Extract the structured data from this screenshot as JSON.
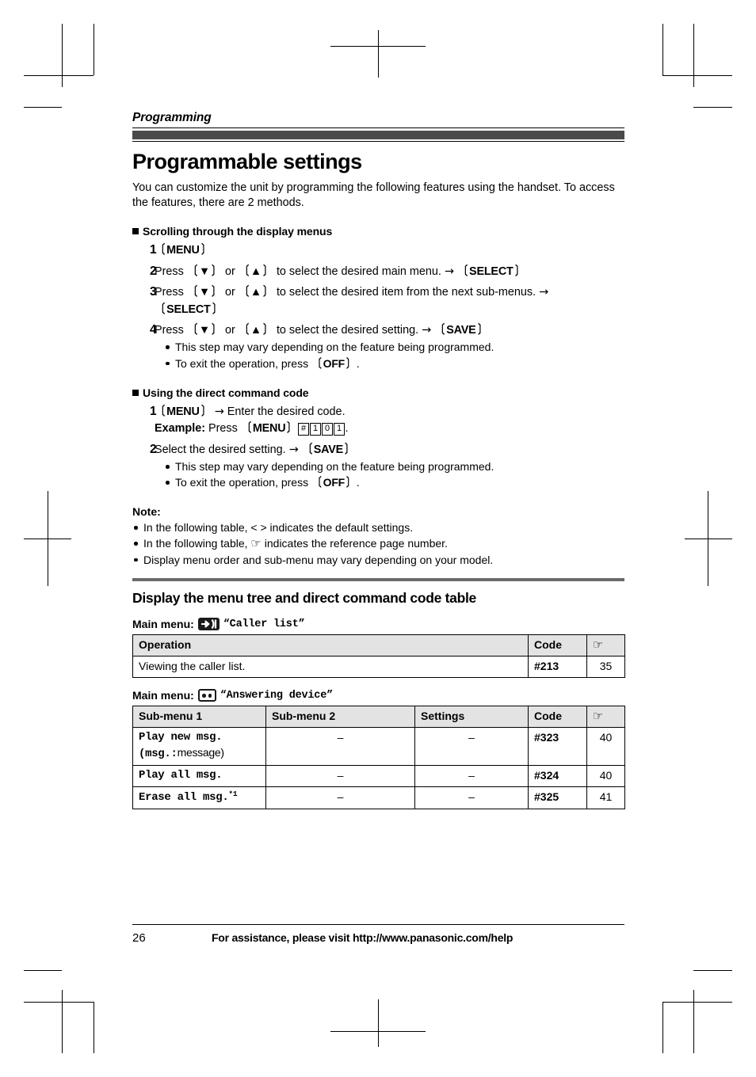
{
  "running_head": "Programming",
  "title": "Programmable settings",
  "intro": "You can customize the unit by programming the following features using the handset. To access the features, there are 2 methods.",
  "section_scrolling": {
    "heading": "Scrolling through the display menus",
    "steps": [
      {
        "num": "1",
        "text_pre": "",
        "key": "MENU",
        "text_post": ""
      },
      {
        "num": "2",
        "text": "Press 〔▼〕 or 〔▲〕 to select the desired main menu. → 〔SELECT〕"
      },
      {
        "num": "3",
        "text": "Press 〔▼〕 or 〔▲〕 to select the desired item from the next sub-menus. → 〔SELECT〕"
      },
      {
        "num": "4",
        "text": "Press 〔▼〕 or 〔▲〕 to select the desired setting. → 〔SAVE〕"
      }
    ],
    "step1_key": "MENU",
    "step2_press": "Press",
    "step2_or": "or",
    "step2_tail": "to select the desired main menu.",
    "step2_key": "SELECT",
    "step3_tail": "to select the desired item from the next sub-menus.",
    "step3_key": "SELECT",
    "step4_tail": "to select the desired setting.",
    "step4_key": "SAVE",
    "bullets": [
      "This step may vary depending on the feature being programmed.",
      "To exit the operation, press"
    ],
    "off_key": "OFF"
  },
  "section_direct": {
    "heading": "Using the direct command code",
    "step1_key": "MENU",
    "step1_text": "Enter the desired code.",
    "example_label": "Example:",
    "example_press": "Press",
    "example_key": "MENU",
    "example_keys": [
      "#",
      "1",
      "0",
      "1"
    ],
    "step2_text": "Select the desired setting.",
    "step2_key": "SAVE",
    "bullets": [
      "This step may vary depending on the feature being programmed.",
      "To exit the operation, press"
    ],
    "off_key": "OFF"
  },
  "note": {
    "label": "Note:",
    "items": [
      "In the following table, < > indicates the default settings.",
      "In the following table, ☞ indicates the reference page number.",
      "Display menu order and sub-menu may vary depending on your model."
    ],
    "item2_pre": "In the following table,",
    "item2_post": "indicates the reference page number."
  },
  "menu_tree": {
    "heading": "Display the menu tree and direct command code table",
    "main_menu_label": "Main menu:"
  },
  "table_caller": {
    "icon": "caller-list-icon",
    "menu_name": "“Caller list”",
    "headers": [
      "Operation",
      "Code",
      "☞"
    ],
    "rows": [
      {
        "operation": "Viewing the caller list.",
        "code": "#213",
        "page": "35"
      }
    ]
  },
  "table_answering": {
    "icon": "answering-device-icon",
    "menu_name": "“Answering device”",
    "headers": [
      "Sub-menu 1",
      "Sub-menu 2",
      "Settings",
      "Code",
      "☞"
    ],
    "rows": [
      {
        "submenu1": "Play new msg.",
        "submenu1_note_mono": "msg.:",
        "submenu1_note_sans": "message",
        "submenu2": "–",
        "settings": "–",
        "code": "#323",
        "page": "40"
      },
      {
        "submenu1": "Play all msg.",
        "submenu2": "–",
        "settings": "–",
        "code": "#324",
        "page": "40"
      },
      {
        "submenu1": "Erase all msg.",
        "footnote": "*1",
        "submenu2": "–",
        "settings": "–",
        "code": "#325",
        "page": "41"
      }
    ]
  },
  "footer": {
    "page_number": "26",
    "text": "For assistance, please visit http://www.panasonic.com/help"
  },
  "colors": {
    "head_bar": "#4a4a4a",
    "section_bar": "#6b6b6b",
    "table_header_bg": "#e3e3e3"
  }
}
